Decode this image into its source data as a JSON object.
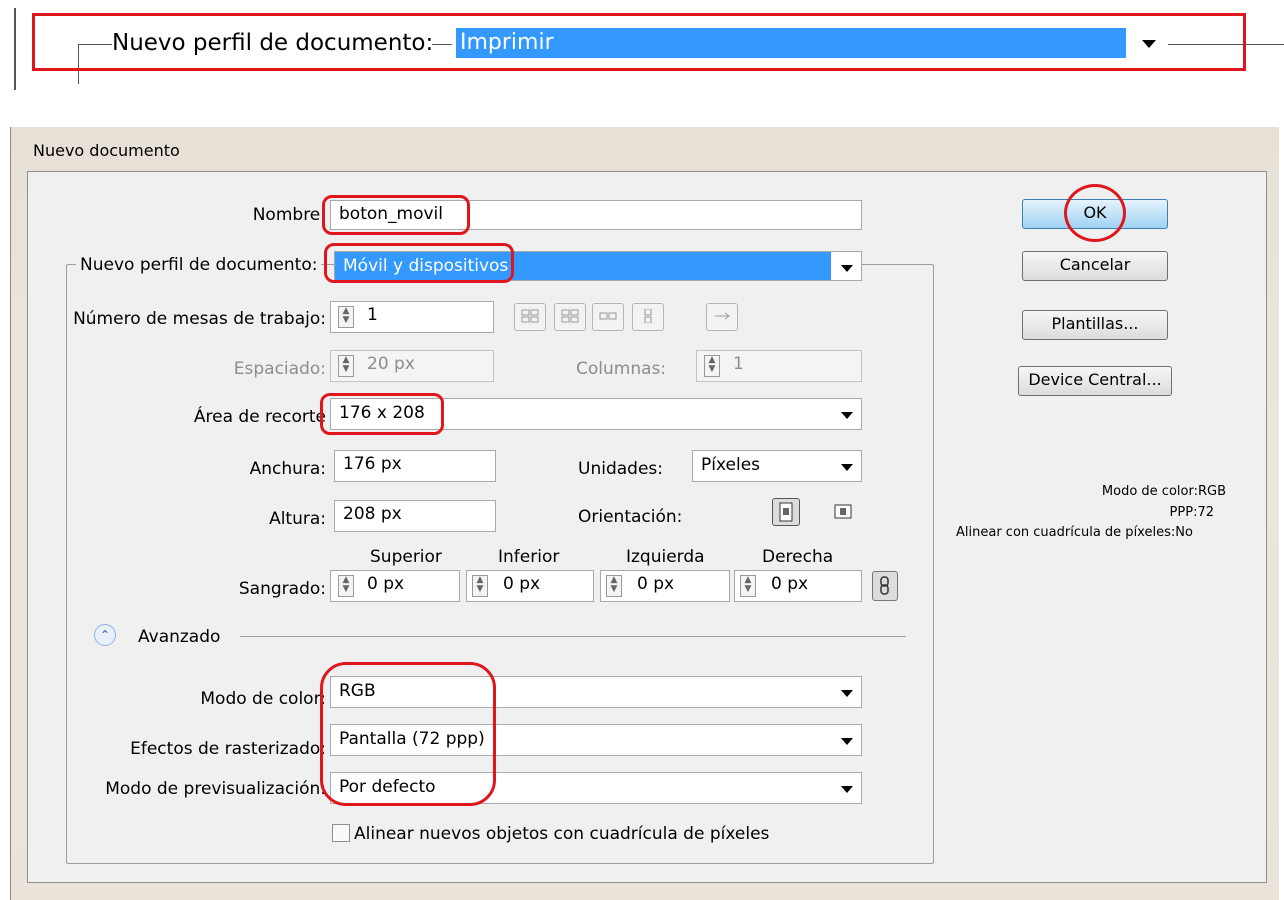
{
  "top": {
    "label": "Nuevo perfil de documento:",
    "value": "Imprimir"
  },
  "dialog": {
    "title": "Nuevo documento",
    "name_label": "Nombre:",
    "name_value": "boton_movil",
    "profile_label": "Nuevo perfil de documento:",
    "profile_value": "Móvil y dispositivos",
    "artboards_label": "Número de mesas de trabajo:",
    "artboards_value": "1",
    "spacing_label": "Espaciado:",
    "spacing_value": "20 px",
    "columns_label": "Columnas:",
    "columns_value": "1",
    "crop_label": "Área de recorte",
    "crop_value": "176 x 208",
    "width_label": "Anchura:",
    "width_value": "176 px",
    "units_label": "Unidades:",
    "units_value": "Píxeles",
    "height_label": "Altura:",
    "height_value": "208 px",
    "orientation_label": "Orientación:",
    "bleed": {
      "label": "Sangrado:",
      "headers": [
        "Superior",
        "Inferior",
        "Izquierda",
        "Derecha"
      ],
      "values": [
        "0 px",
        "0 px",
        "0 px",
        "0 px"
      ]
    },
    "advanced_label": "Avanzado",
    "color_mode_label": "Modo de color:",
    "color_mode_value": "RGB",
    "raster_label": "Efectos de rasterizado:",
    "raster_value": "Pantalla (72 ppp)",
    "preview_label": "Modo de previsualización:",
    "preview_value": "Por defecto",
    "align_checkbox_label": "Alinear nuevos objetos con cuadrícula de píxeles",
    "align_checked": false,
    "buttons": {
      "ok": "OK",
      "cancel": "Cancelar",
      "templates": "Plantillas...",
      "device_central": "Device Central..."
    },
    "info": {
      "color_mode": "Modo de color:RGB",
      "ppp": "PPP:72",
      "align": "Alinear con cuadrícula de píxeles:No"
    }
  },
  "colors": {
    "highlight": "#e0161d",
    "selection": "#3399ff",
    "dialog_bg": "#f0f0f0"
  }
}
